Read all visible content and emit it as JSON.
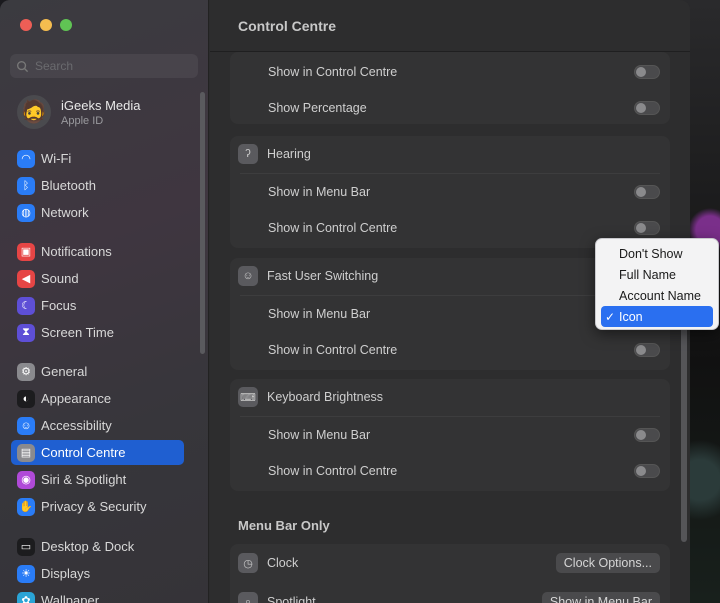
{
  "sidebar": {
    "search_placeholder": "Search",
    "account": {
      "name": "iGeeks Media",
      "subtitle": "Apple ID"
    },
    "items": [
      {
        "label": "Wi-Fi",
        "icon": "wifi-icon",
        "color": "#2a7cf6"
      },
      {
        "label": "Bluetooth",
        "icon": "bluetooth-icon",
        "color": "#2a7cf6"
      },
      {
        "label": "Network",
        "icon": "globe-icon",
        "color": "#2a7cf6"
      },
      {
        "label": "Notifications",
        "icon": "bell-icon",
        "color": "#e64545"
      },
      {
        "label": "Sound",
        "icon": "speaker-icon",
        "color": "#e64545"
      },
      {
        "label": "Focus",
        "icon": "moon-icon",
        "color": "#5e4fd6"
      },
      {
        "label": "Screen Time",
        "icon": "hourglass-icon",
        "color": "#5e4fd6"
      },
      {
        "label": "General",
        "icon": "gear-icon",
        "color": "#8a8a8e"
      },
      {
        "label": "Appearance",
        "icon": "appearance-icon",
        "color": "#1c1c1e"
      },
      {
        "label": "Accessibility",
        "icon": "accessibility-icon",
        "color": "#2a7cf6"
      },
      {
        "label": "Control Centre",
        "icon": "control-centre-icon",
        "color": "#8a8a8e"
      },
      {
        "label": "Siri & Spotlight",
        "icon": "siri-icon",
        "color": "#b04ad8"
      },
      {
        "label": "Privacy & Security",
        "icon": "hand-icon",
        "color": "#2a7cf6"
      },
      {
        "label": "Desktop & Dock",
        "icon": "dock-icon",
        "color": "#1c1c1e"
      },
      {
        "label": "Displays",
        "icon": "display-icon",
        "color": "#2a7cf6"
      },
      {
        "label": "Wallpaper",
        "icon": "wallpaper-icon",
        "color": "#2aa4d6"
      }
    ],
    "active": "Control Centre"
  },
  "main": {
    "title": "Control Centre",
    "group1": {
      "rows": [
        "Show in Control Centre",
        "Show Percentage"
      ]
    },
    "hearing": {
      "title": "Hearing",
      "rows": [
        "Show in Menu Bar",
        "Show in Control Centre"
      ]
    },
    "fast_user": {
      "title": "Fast User Switching",
      "rows": [
        "Show in Menu Bar",
        "Show in Control Centre"
      ]
    },
    "keyboard": {
      "title": "Keyboard Brightness",
      "rows": [
        "Show in Menu Bar",
        "Show in Control Centre"
      ]
    },
    "menu_bar_only": {
      "title": "Menu Bar Only",
      "clock": {
        "label": "Clock",
        "button": "Clock Options..."
      },
      "spotlight": {
        "label": "Spotlight",
        "button": "Show in Menu Bar"
      }
    }
  },
  "dropdown": {
    "options": [
      "Don't Show",
      "Full Name",
      "Account Name",
      "Icon"
    ],
    "selected": "Icon"
  }
}
